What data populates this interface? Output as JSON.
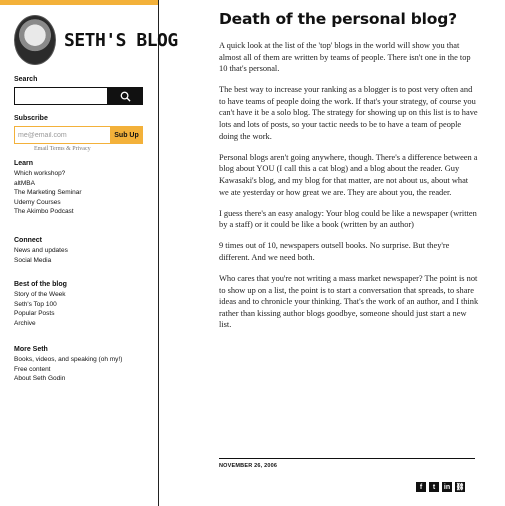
{
  "brand": {
    "title": "SETH'S BLOG"
  },
  "search": {
    "label": "Search",
    "placeholder": ""
  },
  "subscribe": {
    "label": "Subscribe",
    "email_placeholder": "me@email.com",
    "button_label": "Sub Up",
    "privacy": "Email Terms & Privacy"
  },
  "nav": {
    "learn": {
      "heading": "Learn",
      "items": [
        "Which workshop?",
        "altMBA",
        "The Marketing Seminar",
        "Udemy Courses",
        "The Akimbo Podcast"
      ]
    },
    "connect": {
      "heading": "Connect",
      "items": [
        "News and updates",
        "Social Media"
      ]
    },
    "best": {
      "heading": "Best of the blog",
      "items": [
        "Story of the Week",
        "Seth's Top 100",
        "Popular Posts",
        "Archive"
      ]
    },
    "more": {
      "heading": "More Seth",
      "items": [
        "Books, videos, and speaking (oh my!)",
        "Free content",
        "About Seth Godin"
      ]
    }
  },
  "post": {
    "title": "Death of the personal blog?",
    "paragraphs": [
      "A quick look at the list of the 'top' blogs in the world will show you that almost all of them are written by teams of people. There isn't one in the top 10 that's personal.",
      "The best way to increase your ranking as a blogger is to post very often and to have teams of people doing the work. If that's your strategy, of course you can't have it be a solo blog. The strategy for showing up on this list is to have lots and lots of posts, so your tactic needs to be to have a team of people doing the work.",
      "Personal blogs aren't going anywhere, though. There's a difference between a blog about YOU (I call this a cat blog) and a blog about the reader. Guy Kawasaki's blog, and my blog for that matter, are not about us, about what we ate yesterday or how great we are. They are about you, the reader.",
      "I guess there's an easy analogy: Your blog could be like a newspaper (written by a staff) or it could be like a book (written by an author)",
      "9 times out of 10, newspapers outsell books. No surprise. But they're different. And we need both.",
      "Who cares that you're not writing a mass market newspaper? The point is not to show up on a list, the point is to start a conversation that spreads, to share ideas and to chronicle your thinking. That's the work of an author, and I think rather than kissing author blogs goodbye, someone should just start a new list."
    ],
    "date": "NOVEMBER 26, 2006"
  },
  "share": {
    "icons": [
      "facebook-icon",
      "twitter-icon",
      "linkedin-icon",
      "link-icon"
    ],
    "glyphs": [
      "f",
      "t",
      "in",
      "⛓"
    ]
  },
  "colors": {
    "accent": "#f3b13a",
    "text": "#222222",
    "dark": "#111111"
  }
}
